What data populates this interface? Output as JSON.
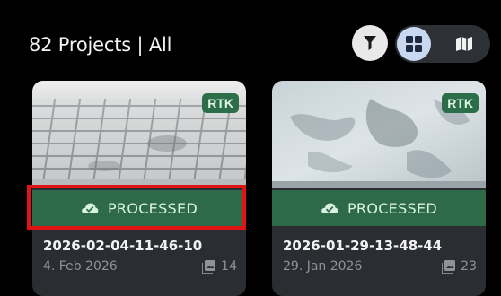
{
  "header": {
    "title": "82 Projects | All"
  },
  "toolbar": {
    "filter_icon": "filter-icon",
    "grid_icon": "grid-view-icon",
    "map_icon": "map-view-icon",
    "active_view": "grid"
  },
  "projects": [
    {
      "name": "2026-02-04-11-46-10",
      "date": "4. Feb 2026",
      "image_count": "14",
      "badge": "RTK",
      "status": "PROCESSED"
    },
    {
      "name": "2026-01-29-13-48-44",
      "date": "29. Jan 2026",
      "image_count": "23",
      "badge": "RTK",
      "status": "PROCESSED"
    }
  ],
  "colors": {
    "background": "#000000",
    "card": "#2a2d31",
    "status_green": "#2e6a48",
    "highlight": "#e01414",
    "toggle_active": "#c8d8f0"
  }
}
